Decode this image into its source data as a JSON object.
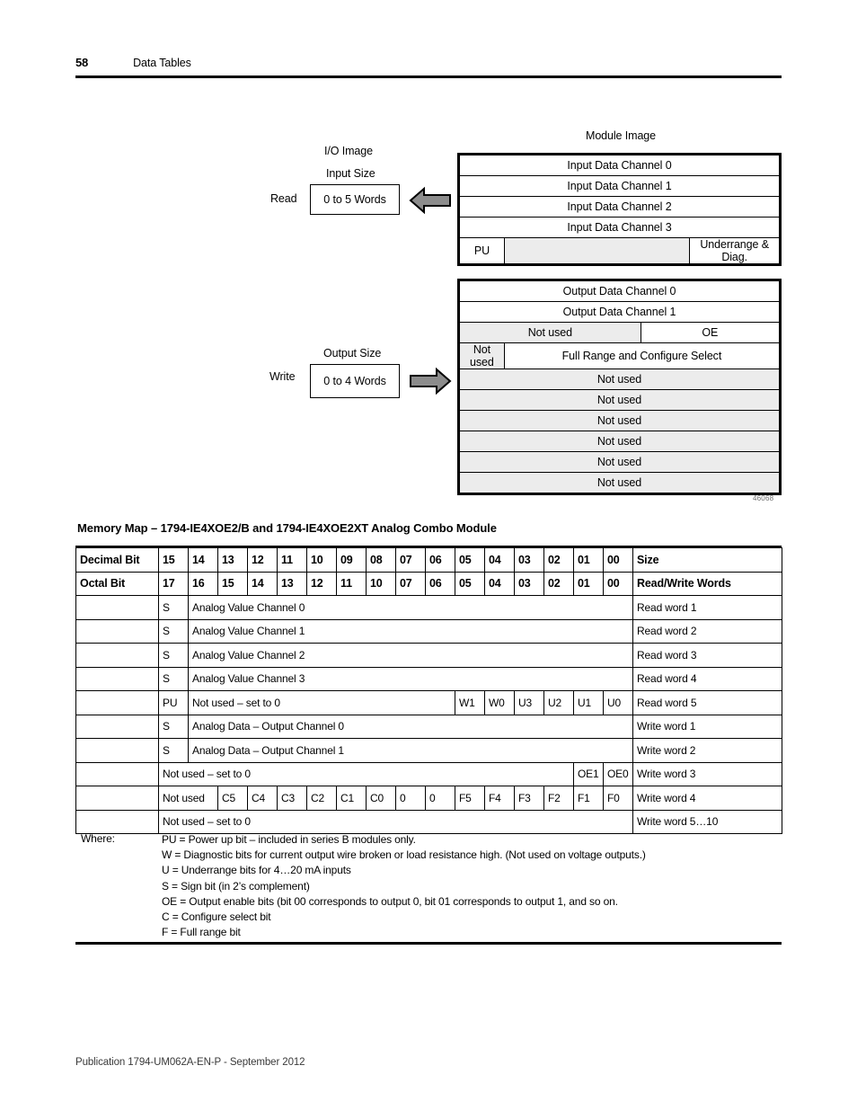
{
  "header": {
    "page_number": "58",
    "title": "Data Tables"
  },
  "figure": {
    "module_image_title": "Module Image",
    "io_image_label": "I/O Image",
    "input_size_label": "Input Size",
    "output_size_label": "Output Size",
    "read_label": "Read",
    "write_label": "Write",
    "input_size_value": "0 to 5 Words",
    "output_size_value": "0 to 4 Words",
    "figure_code": "46068",
    "read_arrow_icon": "arrow-left-icon",
    "write_arrow_icon": "arrow-right-icon",
    "input_rows": [
      {
        "cells": [
          {
            "text": "Input Data Channel 0",
            "fill": "white",
            "span": 3
          }
        ]
      },
      {
        "cells": [
          {
            "text": "Input Data Channel 1",
            "fill": "white",
            "span": 3
          }
        ]
      },
      {
        "cells": [
          {
            "text": "Input Data Channel 2",
            "fill": "white",
            "span": 3
          }
        ]
      },
      {
        "cells": [
          {
            "text": "Input Data Channel 3",
            "fill": "white",
            "span": 3
          }
        ]
      },
      {
        "cells": [
          {
            "text": "PU",
            "fill": "white",
            "span": 1
          },
          {
            "text": "",
            "fill": "gray",
            "span": 1
          },
          {
            "text": "Underrange & Diag.",
            "fill": "white",
            "span": 1
          }
        ]
      }
    ],
    "output_rows": [
      {
        "cells": [
          {
            "text": "Output Data Channel 0",
            "fill": "white",
            "span": 3
          }
        ]
      },
      {
        "cells": [
          {
            "text": "Output Data Channel 1",
            "fill": "white",
            "span": 3
          }
        ]
      },
      {
        "cells": [
          {
            "text": "Not used",
            "fill": "gray",
            "span": 2
          },
          {
            "text": "OE",
            "fill": "white",
            "span": 1
          }
        ]
      },
      {
        "cells": [
          {
            "text": "Not used",
            "fill": "gray",
            "span": 1
          },
          {
            "text": "Full Range and Configure Select",
            "fill": "white",
            "span": 2
          }
        ]
      },
      {
        "cells": [
          {
            "text": "Not used",
            "fill": "gray",
            "span": 3
          }
        ]
      },
      {
        "cells": [
          {
            "text": "Not used",
            "fill": "gray",
            "span": 3
          }
        ]
      },
      {
        "cells": [
          {
            "text": "Not used",
            "fill": "gray",
            "span": 3
          }
        ]
      },
      {
        "cells": [
          {
            "text": "Not used",
            "fill": "gray",
            "span": 3
          }
        ]
      },
      {
        "cells": [
          {
            "text": "Not used",
            "fill": "gray",
            "span": 3
          }
        ]
      },
      {
        "cells": [
          {
            "text": "Not used",
            "fill": "gray",
            "span": 3
          }
        ]
      }
    ]
  },
  "memory_map": {
    "heading": "Memory Map – 1794-IE4XOE2/B and 1794-IE4XOE2XT Analog Combo Module",
    "header_rows": [
      {
        "label": "Decimal Bit",
        "bits": [
          "15",
          "14",
          "13",
          "12",
          "11",
          "10",
          "09",
          "08",
          "07",
          "06",
          "05",
          "04",
          "03",
          "02",
          "01",
          "00"
        ],
        "size": "Size"
      },
      {
        "label": "Octal Bit",
        "bits": [
          "17",
          "16",
          "15",
          "14",
          "13",
          "12",
          "11",
          "10",
          "07",
          "06",
          "05",
          "04",
          "03",
          "02",
          "01",
          "00"
        ],
        "size": "Read/Write Words"
      }
    ],
    "rows": [
      {
        "lead": "S",
        "span_text": "Analog Value Channel 0",
        "span_from": 1,
        "span_to": 15,
        "tail": [],
        "word": "Read word 1"
      },
      {
        "lead": "S",
        "span_text": "Analog Value Channel 1",
        "span_from": 1,
        "span_to": 15,
        "tail": [],
        "word": "Read word 2"
      },
      {
        "lead": "S",
        "span_text": "Analog Value Channel 2",
        "span_from": 1,
        "span_to": 15,
        "tail": [],
        "word": "Read word 3"
      },
      {
        "lead": "S",
        "span_text": "Analog Value Channel 3",
        "span_from": 1,
        "span_to": 15,
        "tail": [],
        "word": "Read word 4"
      },
      {
        "lead": "PU",
        "span_text": "Not used – set to 0",
        "span_from": 1,
        "span_to": 9,
        "tail": [
          "W1",
          "W0",
          "U3",
          "U2",
          "U1",
          "U0"
        ],
        "word": "Read word 5"
      },
      {
        "lead": "S",
        "span_text": "Analog Data – Output Channel 0",
        "span_from": 1,
        "span_to": 15,
        "tail": [],
        "word": "Write word 1"
      },
      {
        "lead": "S",
        "span_text": "Analog Data – Output Channel 1",
        "span_from": 1,
        "span_to": 15,
        "tail": [],
        "word": "Write word 2"
      },
      {
        "lead": null,
        "span_text": "Not used – set to 0",
        "span_from": 0,
        "span_to": 13,
        "tail": [
          "OE1",
          "OE0"
        ],
        "word": "Write word 3"
      },
      {
        "lead": null,
        "span_text": "Not used",
        "span_from": 0,
        "span_to": 1,
        "tail": [
          "C5",
          "C4",
          "C3",
          "C2",
          "C1",
          "C0",
          "0",
          "0",
          "F5",
          "F4",
          "F3",
          "F2",
          "F1",
          "F0"
        ],
        "word": "Write word 4"
      },
      {
        "lead": null,
        "span_text": "Not used – set to 0",
        "span_from": 0,
        "span_to": 15,
        "tail": [],
        "word": "Write word 5…10"
      }
    ],
    "where_label": "Where:",
    "where_lines": [
      "PU = Power up bit – included in series B modules only.",
      "W = Diagnostic bits for current output wire broken or load resistance high. (Not used on voltage outputs.)",
      "U = Underrange bits for 4…20 mA inputs",
      "S = Sign bit (in 2’s complement)",
      "OE = Output enable bits (bit 00 corresponds to output 0, bit 01 corresponds to output 1, and so on.",
      "C = Configure select bit",
      "F = Full range bit"
    ]
  },
  "footer": {
    "publication": "Publication 1794-UM062A-EN-P - September 2012"
  },
  "colors": {
    "gray_fill": "#ececec",
    "arrow_fill": "#8c8c8c",
    "rule": "#000000"
  }
}
